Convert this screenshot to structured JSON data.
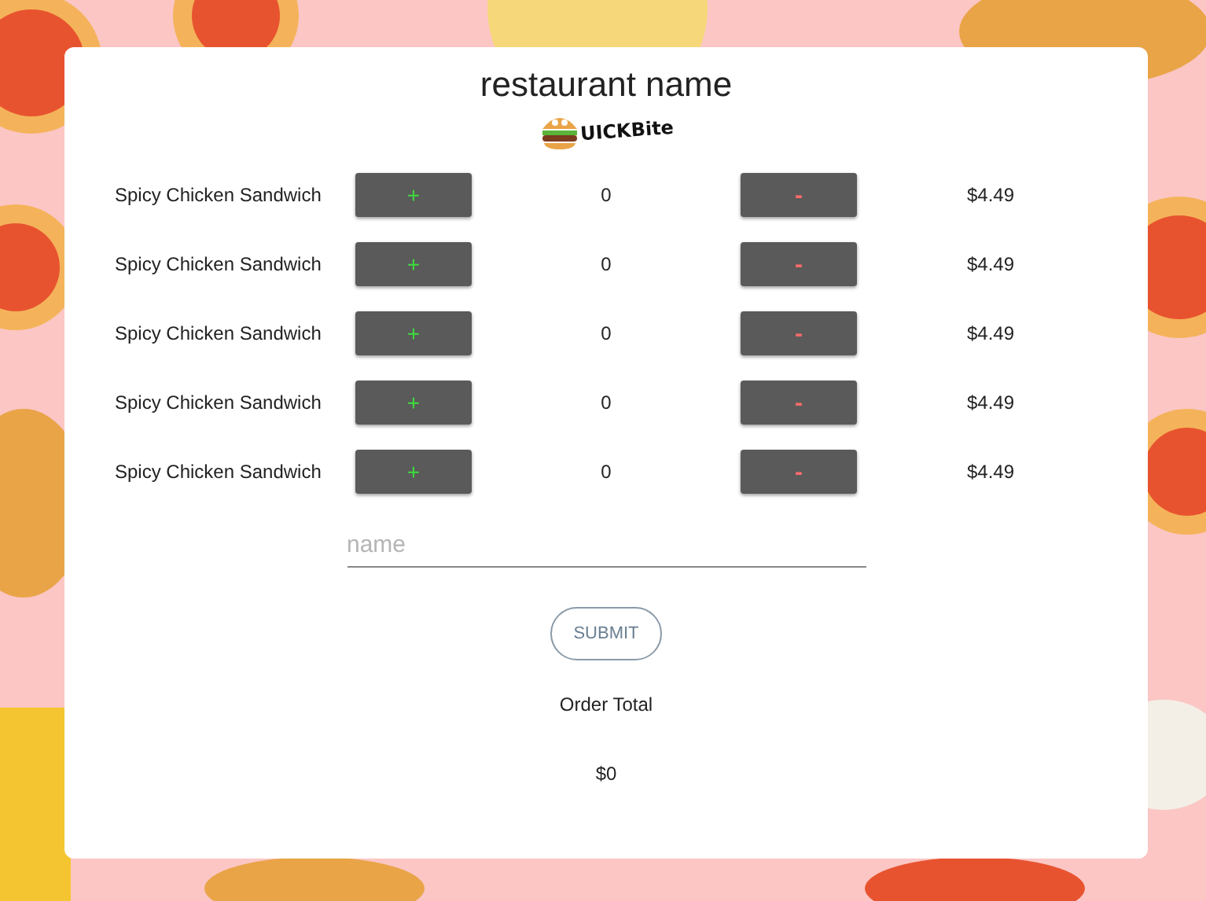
{
  "header": {
    "title": "restaurant name",
    "logo_text": "UICKBite"
  },
  "items": [
    {
      "name": "Spicy Chicken Sandwich",
      "add": "+",
      "quantity": "0",
      "remove": "-",
      "price": "$4.49"
    },
    {
      "name": "Spicy Chicken Sandwich",
      "add": "+",
      "quantity": "0",
      "remove": "-",
      "price": "$4.49"
    },
    {
      "name": "Spicy Chicken Sandwich",
      "add": "+",
      "quantity": "0",
      "remove": "-",
      "price": "$4.49"
    },
    {
      "name": "Spicy Chicken Sandwich",
      "add": "+",
      "quantity": "0",
      "remove": "-",
      "price": "$4.49"
    },
    {
      "name": "Spicy Chicken Sandwich",
      "add": "+",
      "quantity": "0",
      "remove": "-",
      "price": "$4.49"
    }
  ],
  "name_field": {
    "placeholder": "name"
  },
  "submit": "SUBMIT",
  "total": {
    "label": "Order Total",
    "value": "$0"
  }
}
